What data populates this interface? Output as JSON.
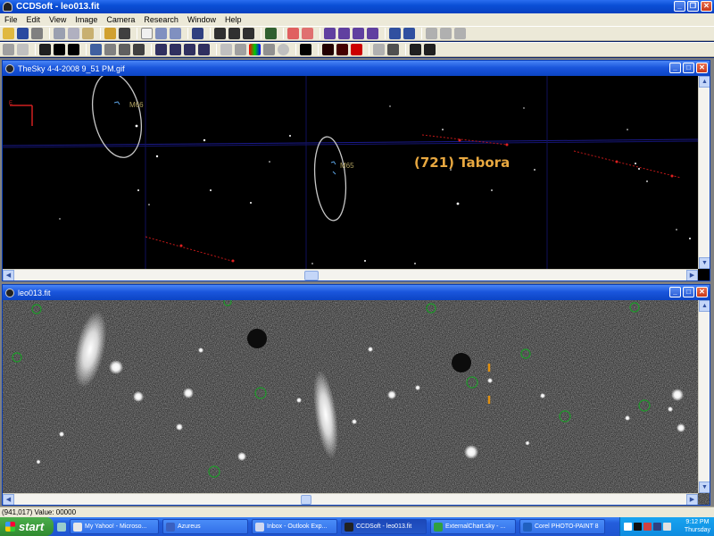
{
  "window": {
    "title": "CCDSoft - leo013.fit"
  },
  "menu": [
    "File",
    "Edit",
    "View",
    "Image",
    "Camera",
    "Research",
    "Window",
    "Help"
  ],
  "sky_window": {
    "title": "TheSky 4-4-2008 9_51 PM.gif",
    "labels": {
      "m66": "M66",
      "m65": "M65",
      "asteroid": "(721) Tabora"
    }
  },
  "image_window": {
    "title": "leo013.fit"
  },
  "status": {
    "text": "(941,017) Value: 00000"
  },
  "taskbar": {
    "start": "start",
    "items": [
      {
        "label": "My Yahoo! - Microso...",
        "icon_color": "#e8e8e8"
      },
      {
        "label": "Azureus",
        "icon_color": "#3a60c0"
      },
      {
        "label": "Inbox - Outlook Exp...",
        "icon_color": "#d0d8f0"
      },
      {
        "label": "CCDSoft - leo013.fit",
        "icon_color": "#222222",
        "active": true
      },
      {
        "label": "ExternalChart.sky - ...",
        "icon_color": "#30a040"
      },
      {
        "label": "Corel PHOTO-PAINT 8",
        "icon_color": "#2060c0"
      }
    ],
    "clock": {
      "time": "9:12 PM",
      "day": "Thursday"
    }
  }
}
